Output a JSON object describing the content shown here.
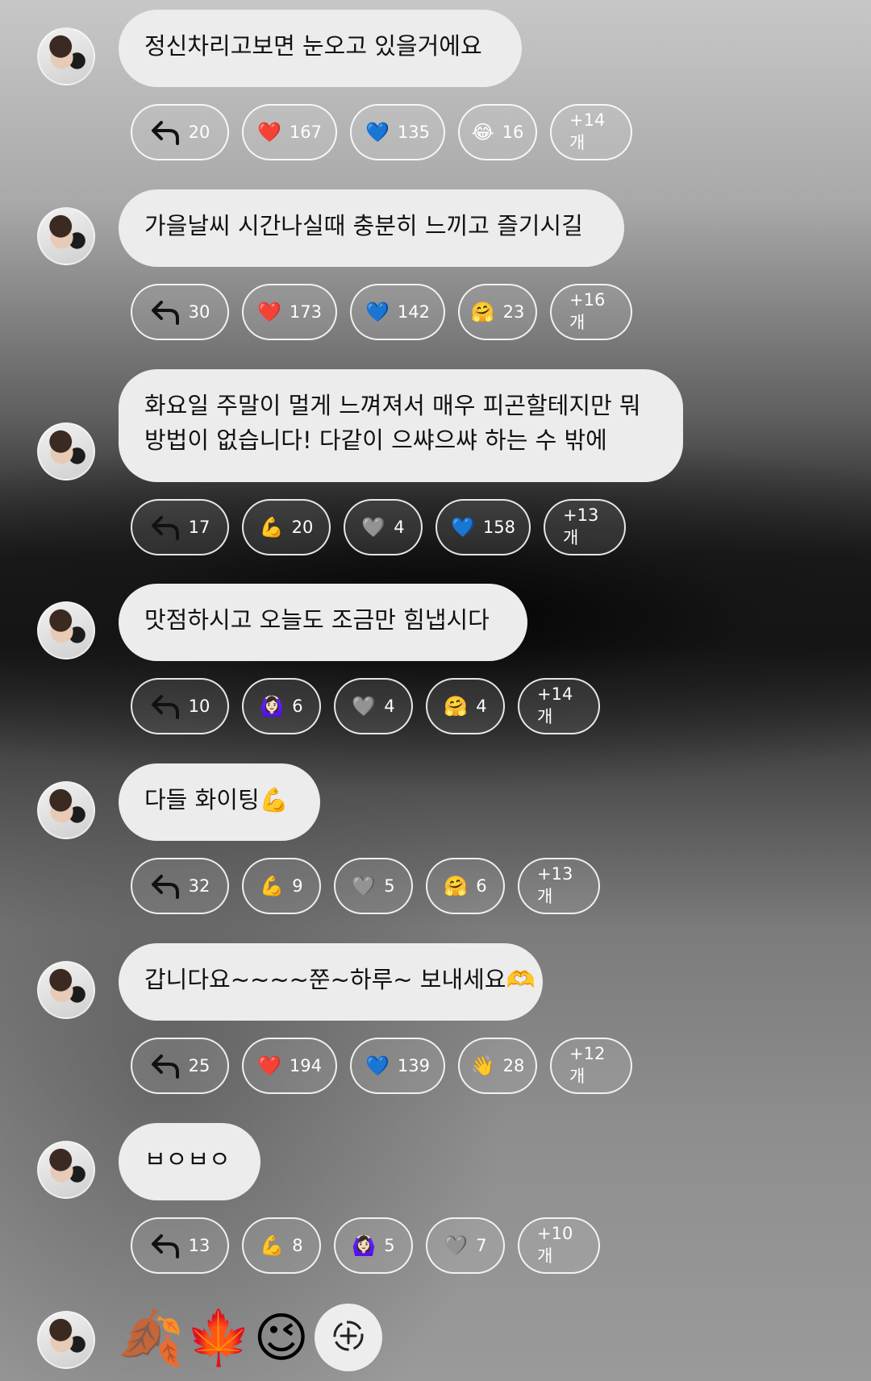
{
  "messages": [
    {
      "text": "정신차리고보면 눈오고 있을거에요",
      "reactions": {
        "reply": "20",
        "items": [
          {
            "emoji": "❤️",
            "count": "167"
          },
          {
            "emoji": "💙",
            "count": "135"
          },
          {
            "emoji": "😂",
            "count": "16"
          }
        ],
        "more": "+14개"
      }
    },
    {
      "text": "가을날씨 시간나실때 충분히 느끼고 즐기시길",
      "reactions": {
        "reply": "30",
        "items": [
          {
            "emoji": "❤️",
            "count": "173"
          },
          {
            "emoji": "💙",
            "count": "142"
          },
          {
            "emoji": "🤗",
            "count": "23"
          }
        ],
        "more": "+16개"
      }
    },
    {
      "text": "화요일 주말이 멀게 느껴져서 매우 피곤할테지만 뭐",
      "text2": "방법이 없습니다! 다같이 으쌰으쌰 하는 수 밖에",
      "reactions": {
        "reply": "17",
        "items": [
          {
            "emoji": "💪",
            "count": "20"
          },
          {
            "emoji": "🩶",
            "count": "4"
          },
          {
            "emoji": "💙",
            "count": "158"
          }
        ],
        "more": "+13개"
      }
    },
    {
      "text": "맛점하시고 오늘도 조금만 힘냅시다",
      "reactions": {
        "reply": "10",
        "items": [
          {
            "emoji": "🙆🏻‍♀️",
            "count": "6"
          },
          {
            "emoji": "🩶",
            "count": "4"
          },
          {
            "emoji": "🤗",
            "count": "4"
          }
        ],
        "more": "+14개"
      }
    },
    {
      "text": "다들 화이팅💪",
      "reactions": {
        "reply": "32",
        "items": [
          {
            "emoji": "💪",
            "count": "9"
          },
          {
            "emoji": "🩶",
            "count": "5"
          },
          {
            "emoji": "🤗",
            "count": "6"
          }
        ],
        "more": "+13개"
      }
    },
    {
      "text": "갑니다요~~~~쭌~하루~ 보내세요🫶",
      "reactions": {
        "reply": "25",
        "items": [
          {
            "emoji": "❤️",
            "count": "194"
          },
          {
            "emoji": "💙",
            "count": "139"
          },
          {
            "emoji": "👋",
            "count": "28"
          }
        ],
        "more": "+12개"
      }
    },
    {
      "text": "ㅂㅇㅂㅇ",
      "reactions": {
        "reply": "13",
        "items": [
          {
            "emoji": "💪",
            "count": "8"
          },
          {
            "emoji": "🙆🏻‍♀️",
            "count": "5"
          },
          {
            "emoji": "🩶",
            "count": "7"
          }
        ],
        "more": "+10개"
      }
    }
  ],
  "last_message": {
    "emojis": "🍂🍁😉"
  },
  "icons": {
    "reply": "reply-arrow-icon",
    "add_reaction": "add-reaction-icon"
  }
}
